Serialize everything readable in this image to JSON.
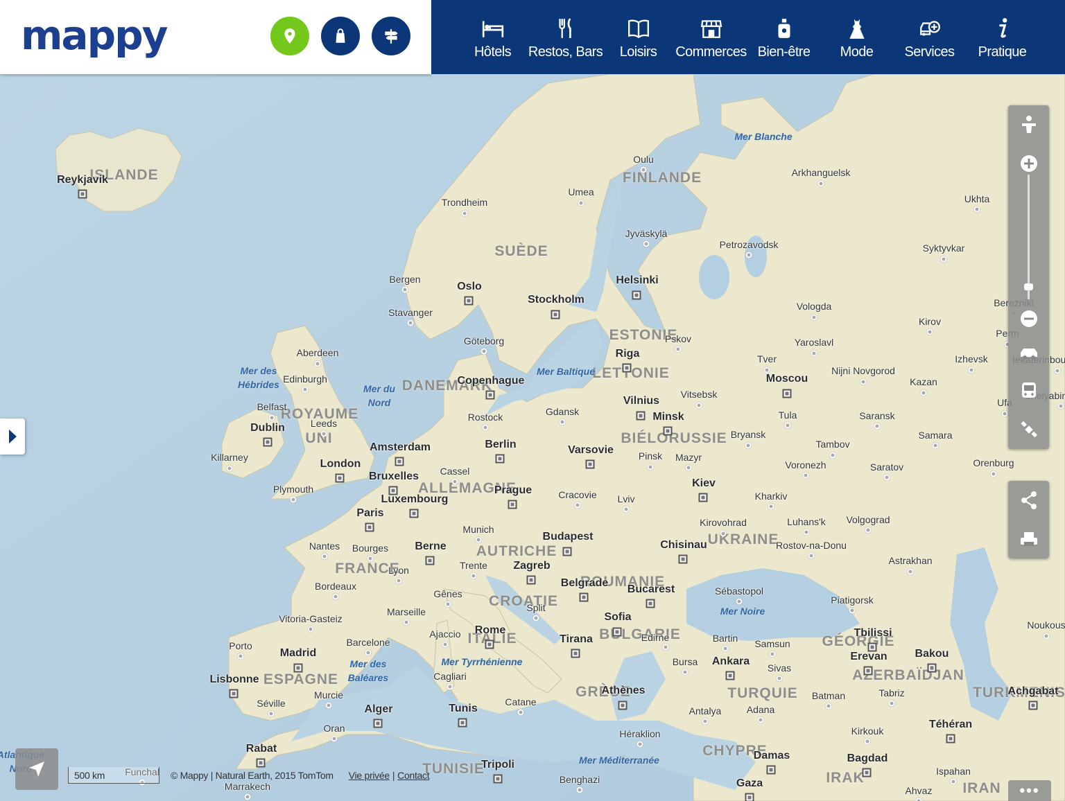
{
  "brand": {
    "logo_text": "mappy"
  },
  "header_buttons": [
    {
      "name": "location-pin-button",
      "icon": "location-pin-icon",
      "color": "#73c81b"
    },
    {
      "name": "shopping-bag-button",
      "icon": "shopping-bag-icon",
      "color": "#0b3678"
    },
    {
      "name": "directions-button",
      "icon": "signpost-icon",
      "color": "#0b3678"
    }
  ],
  "nav": {
    "items": [
      {
        "label": "Hôtels",
        "icon": "bed-icon"
      },
      {
        "label": "Restos, Bars",
        "icon": "fork-knife-icon"
      },
      {
        "label": "Loisirs",
        "icon": "open-book-icon"
      },
      {
        "label": "Commerces",
        "icon": "storefront-icon"
      },
      {
        "label": "Bien-être",
        "icon": "perfume-bottle-icon"
      },
      {
        "label": "Mode",
        "icon": "dress-icon"
      },
      {
        "label": "Services",
        "icon": "car-plus-icon"
      },
      {
        "label": "Pratique",
        "icon": "info-icon"
      }
    ]
  },
  "map_labels": {
    "countries": [
      "ISLANDE",
      "FINLANDE",
      "SUÈDE",
      "ESTONIE",
      "LETTONIE",
      "DANEMARK",
      "ROYAUME",
      "UNI",
      "BIÉLORUSSIE",
      "ALLEMAGNE",
      "FRANCE",
      "AUTRICHE",
      "ROUMANIE",
      "CROATIE",
      "UKRAINE",
      "ITALIE",
      "BULGARIE",
      "ESPAGNE",
      "GRÈCE",
      "TURQUIE",
      "GÉORGIE",
      "AZERBAÏDJAN",
      "CHYPRE",
      "TUNISIE",
      "IRAK",
      "IRAN",
      "TURKMENIS"
    ],
    "seas": [
      "Mer Blanche",
      "Mer des\nHébrides",
      "Mer du\nNord",
      "Mer Baltique",
      "Mer Noire",
      "Mer des\nBaléares",
      "Mer Tyrrhénienne",
      "Mer Méditerranée",
      "Atlantique\nNord"
    ],
    "capitals": [
      "Reykjavik",
      "Oslo",
      "Stockholm",
      "Helsinki",
      "Riga",
      "Copenhague",
      "Moscou",
      "Vilnius",
      "Minsk",
      "Dublin",
      "London",
      "Amsterdam",
      "Berlin",
      "Varsovie",
      "Bruxelles",
      "Luxembourg",
      "Paris",
      "Prague",
      "Kiev",
      "Berne",
      "Budapest",
      "Chisinau",
      "Zagreb",
      "Belgrade",
      "Bucarest",
      "Sofia",
      "Rome",
      "Tirana",
      "Madrid",
      "Lisbonne",
      "Ankara",
      "Tbilissi",
      "Erevan",
      "Bakou",
      "Athènes",
      "Alger",
      "Tunis",
      "Rabat",
      "Tripoli",
      "Damas",
      "Bagdad",
      "Téhéran",
      "Achgabat",
      "Gaza"
    ],
    "cities": [
      "Oulu",
      "Umea",
      "Arkhanguelsk",
      "Ukhta",
      "Trondheim",
      "Jyväskylä",
      "Petrozavodsk",
      "Syktyvkar",
      "Bergen",
      "Stavanger",
      "Vologda",
      "Berezniki",
      "Kirov",
      "Göteborg",
      "Pskov",
      "Yaroslavl",
      "Perm",
      "Aberdeen",
      "Tver",
      "Izhevsk",
      "Iekaterinbourg",
      "Edinburgh",
      "Nijni Novgorod",
      "Kazan",
      "Vitsebsk",
      "Tula",
      "Saransk",
      "Belfast",
      "Leeds",
      "Rostock",
      "Gdansk",
      "Bryansk",
      "Samara",
      "Ufa",
      "Chelyabinsk",
      "Killarney",
      "Cassel",
      "Pinsk",
      "Mazyr",
      "Tambov",
      "Voronezh",
      "Saratov",
      "Orenburg",
      "Plymouth",
      "Cracovie",
      "Lviv",
      "Kharkiv",
      "Kirovohrad",
      "Luhans'k",
      "Volgograd",
      "Munich",
      "Rostov-na-Donu",
      "Nantes",
      "Bourges",
      "Trente",
      "Lyon",
      "Astrakhan",
      "Bordeaux",
      "Gênes",
      "Split",
      "Sébastopol",
      "Piatigorsk",
      "Marseille",
      "Vitoria-Gasteiz",
      "Ajaccio",
      "Edirne",
      "Bartin",
      "Samsun",
      "Noukous",
      "Porto",
      "Barcelone",
      "Bursa",
      "Sivas",
      "Cagliari",
      "Murcie",
      "Séville",
      "Catane",
      "Antalya",
      "Adana",
      "Batman",
      "Tabriz",
      "Oran",
      "Héraklion",
      "Kirkouk",
      "Funchal",
      "Marrakech",
      "Benghazi",
      "Ispahan",
      "Ahvaz"
    ]
  },
  "controls": {
    "zoom_level": 0.1
  },
  "footer": {
    "scale_label": "500 km",
    "attribution": "© Mappy | Natural Earth, 2015 TomTom",
    "privacy_link": "Vie privée",
    "separator": "|",
    "contact_link": "Contact"
  },
  "colors": {
    "sea": "#b9d3e3",
    "land": "#eeeacb",
    "nav_bg": "#0b3678",
    "accent_green": "#73c81b",
    "logo_blue": "#1d3f8f"
  }
}
